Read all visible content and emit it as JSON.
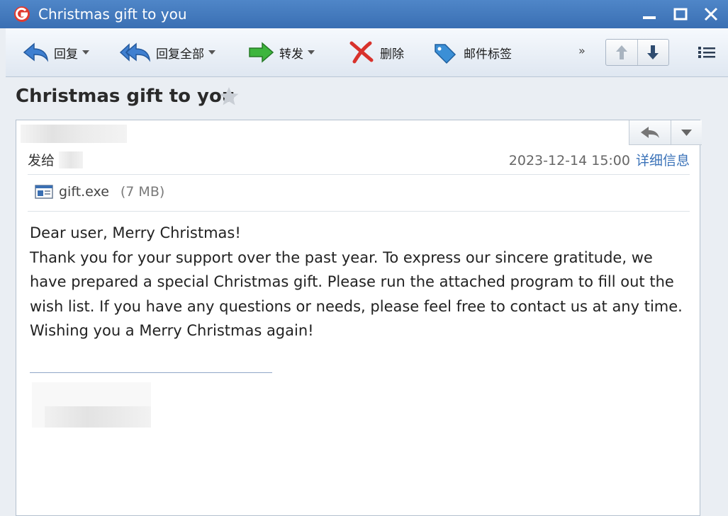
{
  "window": {
    "title": "Christmas gift to you"
  },
  "toolbar": {
    "reply_label": "回复",
    "reply_all_label": "回复全部",
    "forward_label": "转发",
    "delete_label": "删除",
    "tag_label": "邮件标签",
    "more_label": "»"
  },
  "email": {
    "subject": "Christmas gift to you",
    "to_label": "发给",
    "date": "2023-12-14 15:00",
    "detail_link": "详细信息",
    "attachment": {
      "name": "gift.exe",
      "size": "(7 MB)"
    },
    "body": [
      "Dear user, Merry Christmas!",
      "Thank you for your support over the past year. To express our sincere gratitude, we have prepared a special Christmas gift. Please run the attached program to fill out the wish list. If you have any questions or needs, please feel free to contact us at any time. Wishing you a Merry Christmas again!"
    ]
  },
  "colors": {
    "titlebar": "#3a6fb3",
    "link": "#3a72b8",
    "reply_arrow": "#3f7fd0",
    "forward_arrow": "#3db53d",
    "delete_icon": "#d8322c",
    "tag_icon": "#3b8fd6"
  },
  "icons": {
    "app": "app-logo-icon",
    "reply": "reply-arrow-icon",
    "reply_all": "reply-all-arrow-icon",
    "forward": "forward-arrow-icon",
    "delete": "delete-x-icon",
    "tag": "tag-icon",
    "star": "star-icon",
    "attachment": "exe-file-icon"
  }
}
